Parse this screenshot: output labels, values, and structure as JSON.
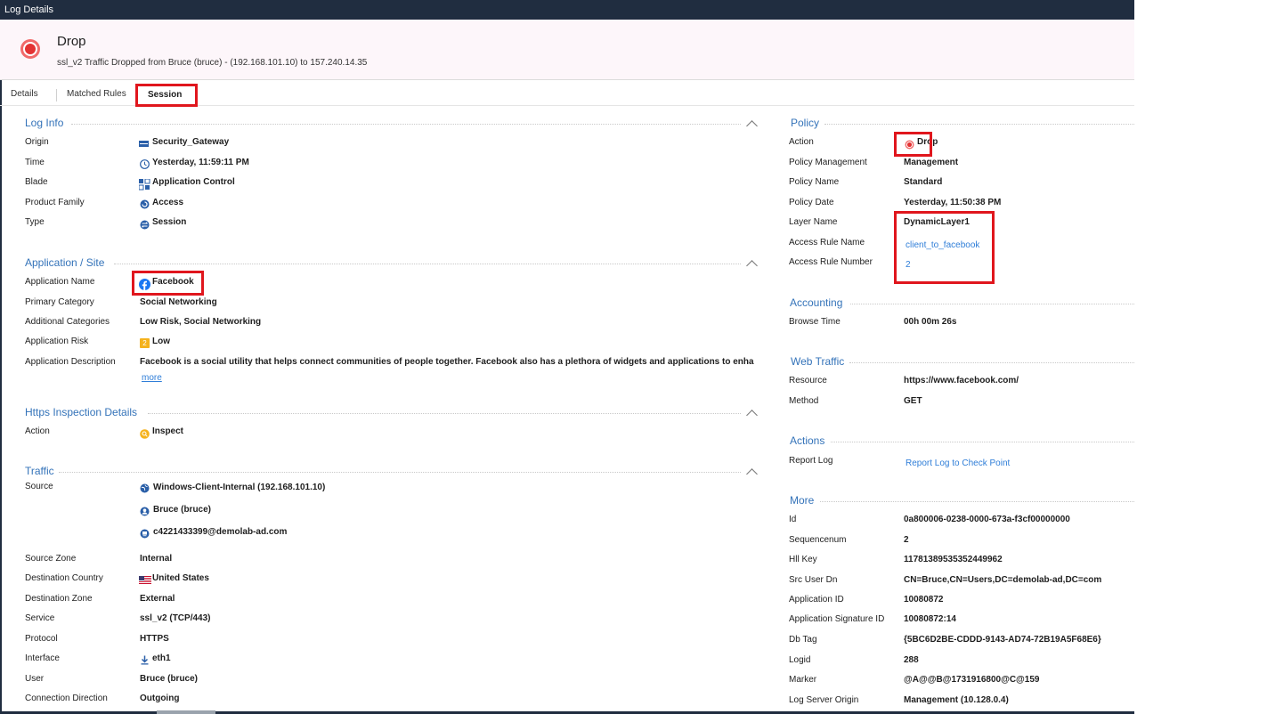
{
  "window": {
    "title": "Log Details"
  },
  "header": {
    "title": "Drop",
    "subtitle": "ssl_v2 Traffic Dropped from Bruce (bruce) - (192.168.101.10) to 157.240.14.35"
  },
  "tabs": [
    {
      "label": "Details"
    },
    {
      "label": "Matched Rules"
    },
    {
      "label": "Session"
    }
  ],
  "left": {
    "log_info": {
      "title": "Log Info",
      "rows": [
        {
          "label": "Origin",
          "value": "Security_Gateway",
          "icon": "gateway-icon"
        },
        {
          "label": "Time",
          "value": "Yesterday, 11:59:11 PM",
          "icon": "clock-icon"
        },
        {
          "label": "Blade",
          "value": "Application Control",
          "icon": "application-control-icon"
        },
        {
          "label": "Product Family",
          "value": "Access",
          "icon": "access-icon"
        },
        {
          "label": "Type",
          "value": "Session",
          "icon": "session-icon"
        }
      ]
    },
    "app_site": {
      "title": "Application / Site",
      "rows": [
        {
          "label": "Application Name",
          "value": "Facebook",
          "icon": "facebook-icon"
        },
        {
          "label": "Primary Category",
          "value": "Social Networking"
        },
        {
          "label": "Additional Categories",
          "value": "Low Risk, Social Networking"
        },
        {
          "label": "Application Risk",
          "value": "Low",
          "icon": "risk-level-icon",
          "badge": "2"
        },
        {
          "label": "Application Description",
          "value": "Facebook is a social utility that helps connect communities of people together. Facebook also has a plethora of widgets and applications to enhan..",
          "more": "more"
        }
      ]
    },
    "https": {
      "title": "Https Inspection Details",
      "rows": [
        {
          "label": "Action",
          "value": "Inspect",
          "icon": "inspect-icon"
        }
      ]
    },
    "traffic": {
      "title": "Traffic",
      "source_label": "Source",
      "source_values": [
        {
          "value": "Windows-Client-Internal (192.168.101.10)",
          "icon": "globe-icon"
        },
        {
          "value": "Bruce (bruce)",
          "icon": "user-icon"
        },
        {
          "value": "c4221433399@demolab-ad.com",
          "icon": "computer-icon"
        }
      ],
      "rows": [
        {
          "label": "Source Zone",
          "value": "Internal"
        },
        {
          "label": "Destination Country",
          "value": "United States",
          "icon": "us-flag-icon"
        },
        {
          "label": "Destination Zone",
          "value": "External"
        },
        {
          "label": "Service",
          "value": "ssl_v2 (TCP/443)"
        },
        {
          "label": "Protocol",
          "value": "HTTPS"
        },
        {
          "label": "Interface",
          "value": "eth1",
          "icon": "download-arrow-icon"
        },
        {
          "label": "User",
          "value": "Bruce (bruce)"
        },
        {
          "label": "Connection Direction",
          "value": "Outgoing"
        }
      ]
    }
  },
  "right": {
    "policy": {
      "title": "Policy",
      "rows": [
        {
          "label": "Action",
          "value": "Drop",
          "icon": "drop-icon"
        },
        {
          "label": "Policy Management",
          "value": "Management"
        },
        {
          "label": "Policy Name",
          "value": "Standard"
        },
        {
          "label": "Policy Date",
          "value": "Yesterday, 11:50:38 PM"
        },
        {
          "label": "Layer Name",
          "value": "DynamicLayer1"
        },
        {
          "label": "Access Rule Name",
          "value": "client_to_facebook"
        },
        {
          "label": "Access Rule Number",
          "value": "2"
        }
      ]
    },
    "accounting": {
      "title": "Accounting",
      "rows": [
        {
          "label": "Browse Time",
          "value": "00h 00m 26s"
        }
      ]
    },
    "web_traffic": {
      "title": "Web Traffic",
      "rows": [
        {
          "label": "Resource",
          "value": "https://www.facebook.com/"
        },
        {
          "label": "Method",
          "value": "GET"
        }
      ]
    },
    "actions": {
      "title": "Actions",
      "rows": [
        {
          "label": "Report Log",
          "value": "Report Log to Check Point"
        }
      ]
    },
    "more": {
      "title": "More",
      "rows": [
        {
          "label": "Id",
          "value": "0a800006-0238-0000-673a-f3cf00000000"
        },
        {
          "label": "Sequencenum",
          "value": "2"
        },
        {
          "label": "Hll Key",
          "value": "11781389535352449962"
        },
        {
          "label": "Src User Dn",
          "value": "CN=Bruce,CN=Users,DC=demolab-ad,DC=com"
        },
        {
          "label": "Application ID",
          "value": "10080872"
        },
        {
          "label": "Application Signature ID",
          "value": "10080872:14"
        },
        {
          "label": "Db Tag",
          "value": "{5BC6D2BE-CDDD-9143-AD74-72B19A5F68E6}"
        },
        {
          "label": "Logid",
          "value": "288"
        },
        {
          "label": "Marker",
          "value": "@A@@B@1731916800@C@159"
        },
        {
          "label": "Log Server Origin",
          "value": "Management (10.128.0.4)"
        }
      ]
    }
  },
  "colors": {
    "titlebar": "#202d40",
    "link": "#2f7ed8",
    "section_title": "#3473b9",
    "highlight_box": "#e0161d",
    "drop_red": "#e33333"
  }
}
